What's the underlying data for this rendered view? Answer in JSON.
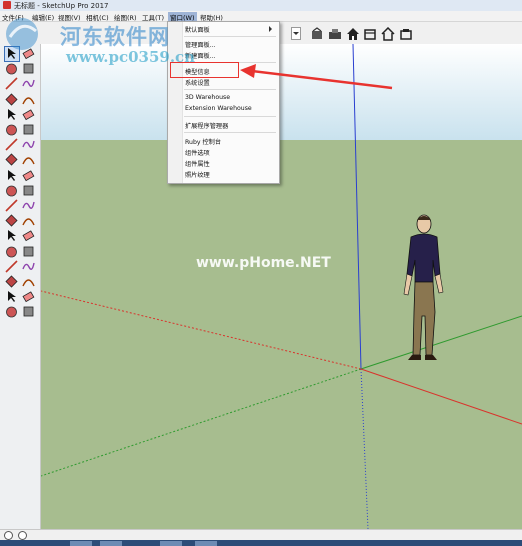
{
  "window": {
    "title": "无标题 - SketchUp Pro 2017"
  },
  "menubar": {
    "items": [
      "文件(F)",
      "编辑(E)",
      "视图(V)",
      "相机(C)",
      "绘图(R)",
      "工具(T)",
      "窗口(W)",
      "帮助(H)"
    ],
    "active_index": 6
  },
  "window_menu": {
    "items": [
      {
        "label": "默认面板",
        "submenu": true
      },
      {
        "label": "管理面板..."
      },
      {
        "label": "新建面板..."
      },
      {
        "label": "模型信息",
        "highlighted": true
      },
      {
        "label": "系统设置"
      },
      {
        "label": "3D Warehouse"
      },
      {
        "label": "Extension Warehouse"
      },
      {
        "label": "扩展程序管理器"
      },
      {
        "label": "Ruby 控制台"
      },
      {
        "label": "组件选项"
      },
      {
        "label": "组件属性"
      },
      {
        "label": "照片纹理"
      }
    ]
  },
  "toolbar": {
    "icons": [
      "warehouse-share-icon",
      "model-upload-icon",
      "house-icon",
      "component-icon",
      "home-outline-icon",
      "extension-icon"
    ]
  },
  "left_tools": [
    "select-tool",
    "eraser-tool",
    "paint-bucket-tool",
    "eraser-alt-tool",
    "line-tool",
    "freehand-tool",
    "rectangle-tool",
    "rotated-rectangle-tool",
    "circle-tool",
    "polygon-tool",
    "arc-tool",
    "two-point-arc-tool",
    "three-point-arc-tool",
    "pie-tool",
    "move-tool",
    "push-pull-tool",
    "rotate-tool",
    "follow-me-tool",
    "scale-tool",
    "offset-tool",
    "tape-measure-tool",
    "dimension-tool",
    "protractor-tool",
    "text-tool",
    "axes-tool",
    "3d-text-tool",
    "orbit-tool",
    "pan-tool",
    "zoom-tool",
    "zoom-window-tool",
    "zoom-extents-tool",
    "previous-view-tool",
    "position-camera-tool",
    "look-around-tool",
    "walk-tool",
    "section-plane-tool"
  ],
  "watermarks": {
    "site_name": "河东软件网",
    "site_url": "www.pc0359.cn",
    "center": "www.pHome.NET"
  },
  "colors": {
    "highlight_box": "#e8332f",
    "axis_red": "#d9332c",
    "axis_green": "#2f9a2f",
    "axis_blue": "#2a3fd0",
    "ground": "#a7bd8f"
  }
}
